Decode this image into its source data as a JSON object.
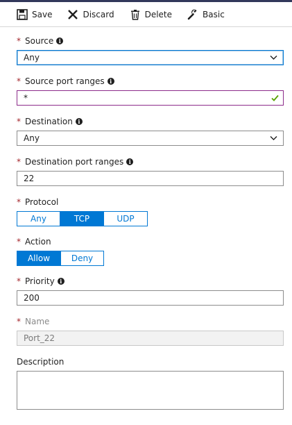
{
  "toolbar": {
    "save_label": "Save",
    "discard_label": "Discard",
    "delete_label": "Delete",
    "basic_label": "Basic"
  },
  "form": {
    "required_marker": "*",
    "source": {
      "label": "Source",
      "value": "Any"
    },
    "source_port_ranges": {
      "label": "Source port ranges",
      "value": "*"
    },
    "destination": {
      "label": "Destination",
      "value": "Any"
    },
    "destination_port_ranges": {
      "label": "Destination port ranges",
      "value": "22"
    },
    "protocol": {
      "label": "Protocol",
      "options": [
        "Any",
        "TCP",
        "UDP"
      ],
      "selected": "TCP"
    },
    "action": {
      "label": "Action",
      "options": [
        "Allow",
        "Deny"
      ],
      "selected": "Allow"
    },
    "priority": {
      "label": "Priority",
      "value": "200"
    },
    "name": {
      "label": "Name",
      "value": "Port_22"
    },
    "description": {
      "label": "Description",
      "value": ""
    }
  },
  "colors": {
    "accent": "#0078d4",
    "required": "#a4262c",
    "valid_check": "#57a300"
  },
  "icons": [
    "save-icon",
    "discard-icon",
    "delete-icon",
    "basic-wrench-icon",
    "info-icon",
    "chevron-down-icon",
    "checkmark-icon"
  ]
}
